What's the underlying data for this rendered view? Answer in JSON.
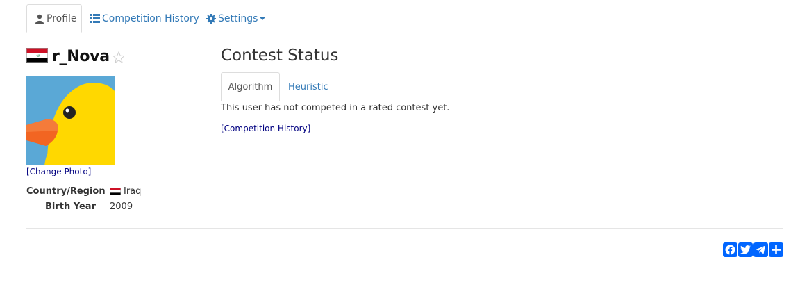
{
  "tabs": {
    "profile": "Profile",
    "competition_history": "Competition History",
    "settings": "Settings"
  },
  "user": {
    "username": "r_Nova",
    "change_photo": "[Change Photo]"
  },
  "info": {
    "country_label": "Country/Region",
    "country_value": "Iraq",
    "birth_label": "Birth Year",
    "birth_value": "2009"
  },
  "contest": {
    "title": "Contest Status",
    "tab_algorithm": "Algorithm",
    "tab_heuristic": "Heuristic",
    "message": "This user has not competed in a rated contest yet.",
    "history_link": "[Competition History]"
  },
  "colors": {
    "link": "#337ab7",
    "dark_link": "#000080",
    "share": "#0166ff"
  },
  "icons": [
    "user-icon",
    "list-icon",
    "gear-icon",
    "star-icon",
    "facebook-icon",
    "twitter-icon",
    "telegram-icon",
    "share-plus-icon"
  ]
}
